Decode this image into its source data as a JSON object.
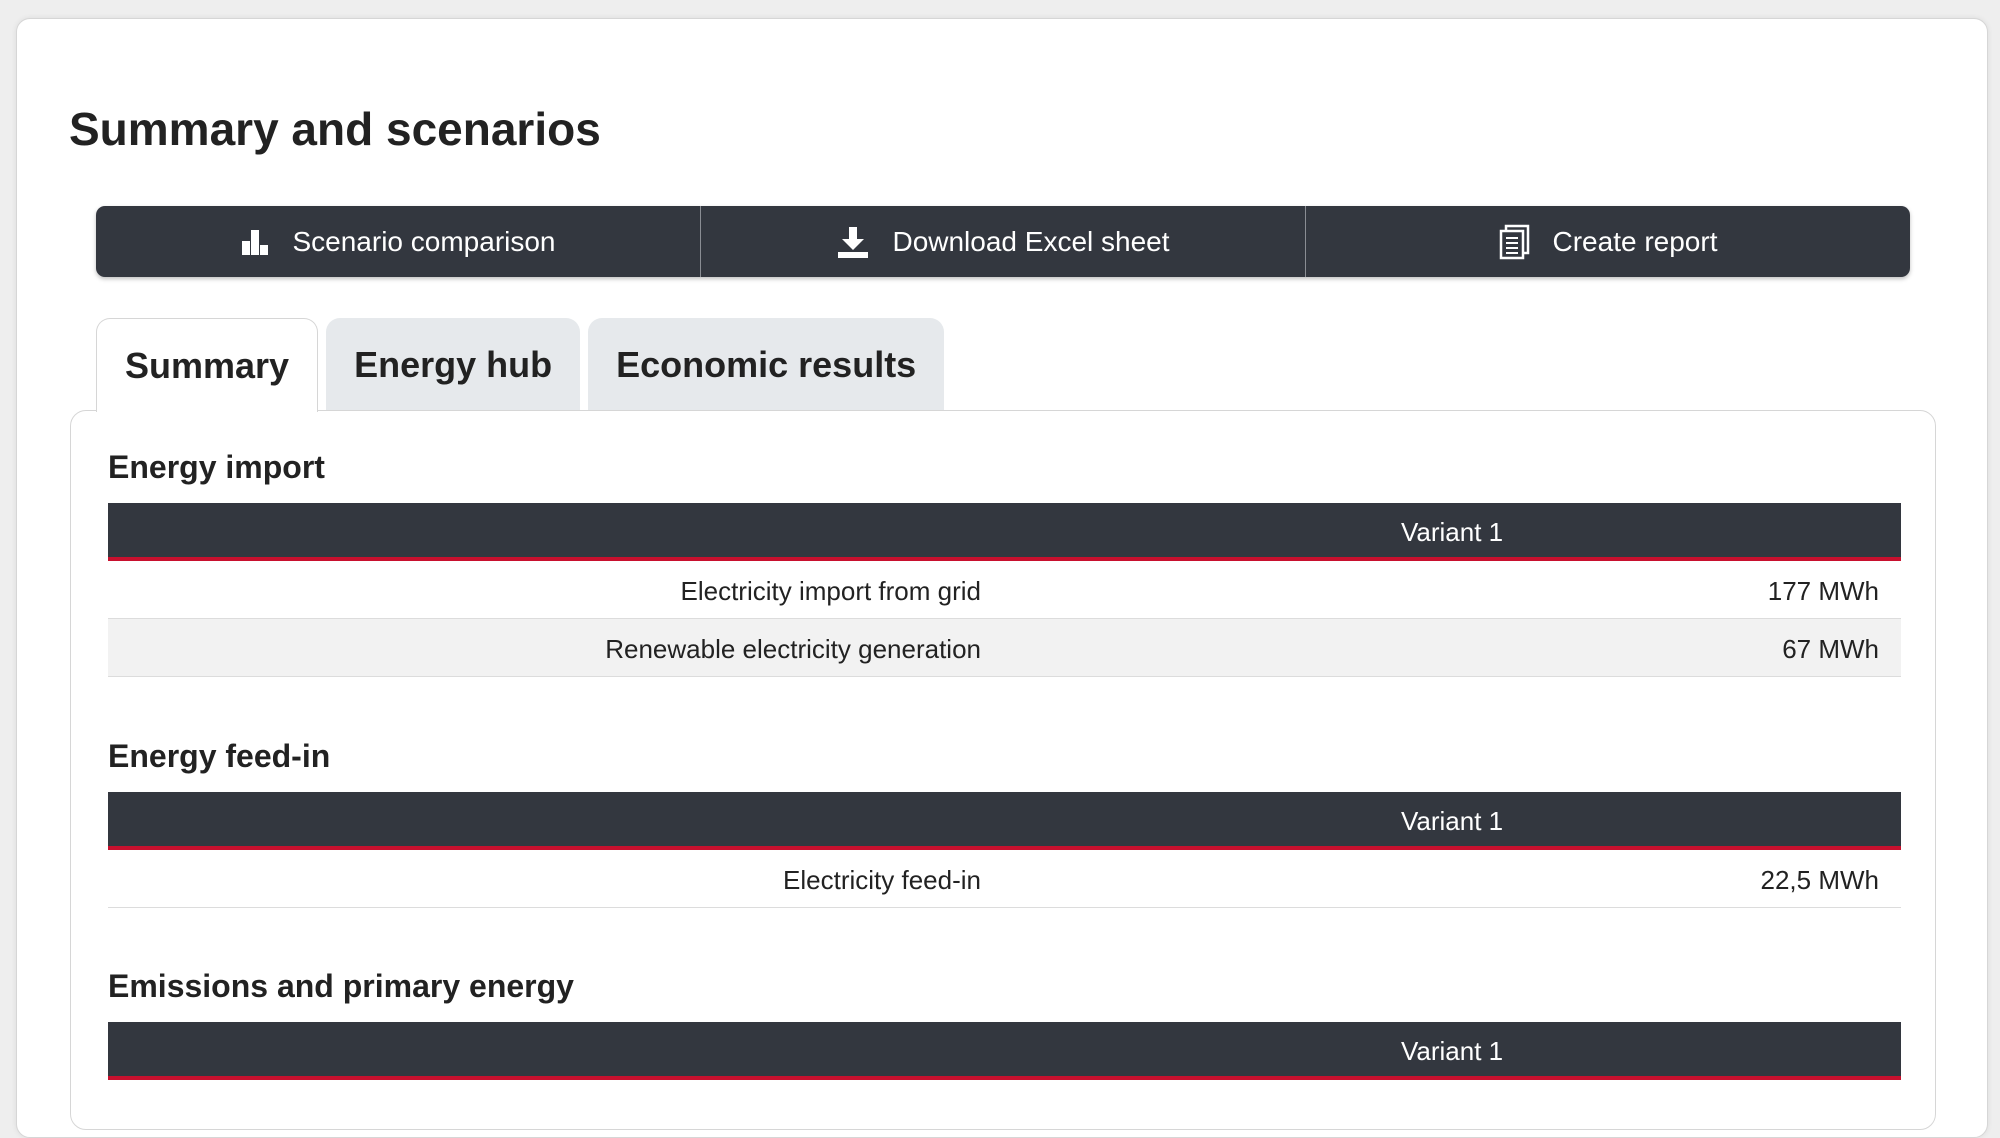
{
  "page": {
    "title": "Summary and scenarios"
  },
  "toolbar": {
    "scenario_comparison": "Scenario comparison",
    "download_excel": "Download Excel sheet",
    "create_report": "Create report",
    "icons": [
      "bar-chart-icon",
      "download-icon",
      "report-icon"
    ]
  },
  "tabs": [
    {
      "label": "Summary",
      "active": true
    },
    {
      "label": "Energy hub",
      "active": false
    },
    {
      "label": "Economic results",
      "active": false
    }
  ],
  "sections": {
    "energy_import": {
      "title": "Energy import",
      "column": "Variant 1",
      "rows": [
        {
          "label": "Electricity import from grid",
          "value": "177 MWh"
        },
        {
          "label": "Renewable electricity generation",
          "value": "67 MWh"
        }
      ]
    },
    "energy_feed_in": {
      "title": "Energy feed-in",
      "column": "Variant 1",
      "rows": [
        {
          "label": "Electricity feed-in",
          "value": "22,5 MWh"
        }
      ]
    },
    "emissions": {
      "title": "Emissions and primary energy",
      "column": "Variant 1"
    }
  },
  "colors": {
    "dark": "#33373f",
    "accent_red": "#c8102e",
    "alt_row": "#f2f2f2"
  }
}
